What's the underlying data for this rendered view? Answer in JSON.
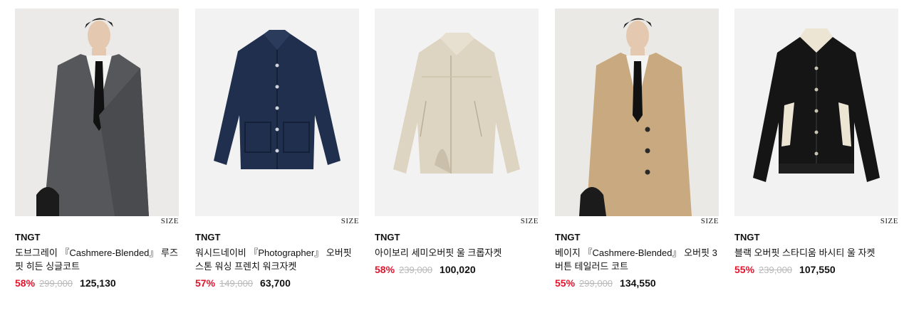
{
  "products": [
    {
      "brand": "TNGT",
      "name": "도브그레이 『Cashmere-Blended』 루즈핏 히든 싱글코트",
      "discount": "58%",
      "original_price": "299,000",
      "price": "125,130",
      "size_label": "SIZE",
      "bg_color": "#ebeae8",
      "garment_color": "#55575a"
    },
    {
      "brand": "TNGT",
      "name": "워시드네이비 『Photographer』 오버핏 스톤 워싱 프렌치 워크자켓",
      "discount": "57%",
      "original_price": "149,000",
      "price": "63,700",
      "size_label": "SIZE",
      "bg_color": "#f2f2f2",
      "garment_color": "#1f2f4d"
    },
    {
      "brand": "TNGT",
      "name": "아이보리 세미오버핏 울 크롭자켓",
      "discount": "58%",
      "original_price": "239,000",
      "price": "100,020",
      "size_label": "SIZE",
      "bg_color": "#f2f2f2",
      "garment_color": "#ddd4c1"
    },
    {
      "brand": "TNGT",
      "name": "베이지 『Cashmere-Blended』 오버핏 3버튼 테일러드 코트",
      "discount": "55%",
      "original_price": "299,000",
      "price": "134,550",
      "size_label": "SIZE",
      "bg_color": "#ebe9e6",
      "garment_color": "#c9a97f"
    },
    {
      "brand": "TNGT",
      "name": "블랙 오버핏 스타디움 바시티 울 자켓",
      "discount": "55%",
      "original_price": "239,000",
      "price": "107,550",
      "size_label": "SIZE",
      "bg_color": "#f2f2f2",
      "garment_color": "#151515"
    }
  ]
}
